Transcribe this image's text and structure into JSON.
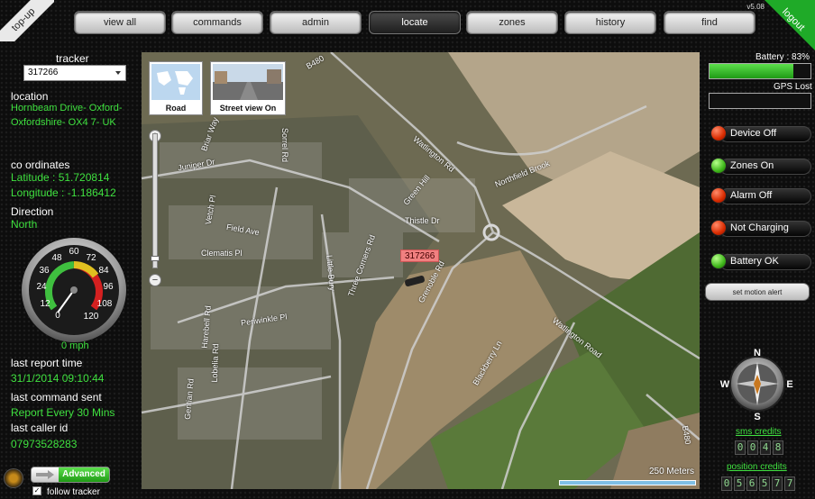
{
  "corners": {
    "topup": "top-up",
    "logout": "logout",
    "version": "v5.08"
  },
  "nav": [
    {
      "label": "view all",
      "active": false
    },
    {
      "label": "commands",
      "active": false
    },
    {
      "label": "admin",
      "active": false
    },
    {
      "label": "locate",
      "active": true
    },
    {
      "label": "zones",
      "active": false
    },
    {
      "label": "history",
      "active": false
    },
    {
      "label": "find",
      "active": false
    }
  ],
  "left": {
    "tracker_label": "tracker",
    "tracker_selected": "317266",
    "location_label": "location",
    "location_line1": "Hornbeam Drive- Oxford-",
    "location_line2": "Oxfordshire- OX4 7- UK",
    "coords_label": "co ordinates",
    "latitude": "Latitude : 51.720814",
    "longitude": "Longitude : -1.186412",
    "direction_label": "Direction",
    "direction": "North",
    "speed": "0 mph",
    "speedo_ticks": [
      "0",
      "12",
      "24",
      "36",
      "48",
      "60",
      "72",
      "84",
      "96",
      "108",
      "120"
    ],
    "last_report_label": "last report time",
    "last_report": "31/1/2014 09:10:44",
    "last_command_label": "last command sent",
    "last_command": "Report Every 30 Mins",
    "last_caller_label": "last caller id",
    "last_caller": "07973528283",
    "advanced_label": "Advanced",
    "follow_label": "follow tracker"
  },
  "map": {
    "road_tile": "Road",
    "street_tile": "Street view On",
    "tracker_tag": "317266",
    "scale": "250 Meters",
    "roads": [
      "B480",
      "Watlington Rd",
      "Northfield Brook",
      "Juniper Dr",
      "Sorrel Rd",
      "Green Hill",
      "Thistle Dr",
      "Field Ave",
      "Clematis Pl",
      "Three Corners Rd",
      "Grenoble Rd",
      "Watlington Road",
      "Blackberry Ln",
      "Little Bury",
      "Periwinkle Pl",
      "Harebell Rd",
      "Lobelia Rd",
      "Gentian Rd",
      "Vetch Pl",
      "Briar Way",
      "B480"
    ]
  },
  "right": {
    "battery_label": "Battery : 83%",
    "battery_fraction": 0.83,
    "gps_label": "GPS Lost",
    "statuses": [
      {
        "label": "Device Off",
        "color": "red"
      },
      {
        "label": "Zones On",
        "color": "green"
      },
      {
        "label": "Alarm Off",
        "color": "red"
      },
      {
        "label": "Not Charging",
        "color": "red"
      },
      {
        "label": "Battery OK",
        "color": "green"
      }
    ],
    "motion_alert": "set motion alert",
    "compass": {
      "n": "N",
      "s": "S",
      "e": "E",
      "w": "W"
    },
    "sms_label": "sms credits",
    "sms_digits": [
      "0",
      "0",
      "4",
      "8"
    ],
    "position_label": "position credits",
    "position_digits": [
      "0",
      "5",
      "6",
      "5",
      "7",
      "7"
    ]
  },
  "colors": {
    "accent_green": "#3fe13f",
    "battery_green": "#2fb520",
    "tag_red": "#f08080"
  }
}
